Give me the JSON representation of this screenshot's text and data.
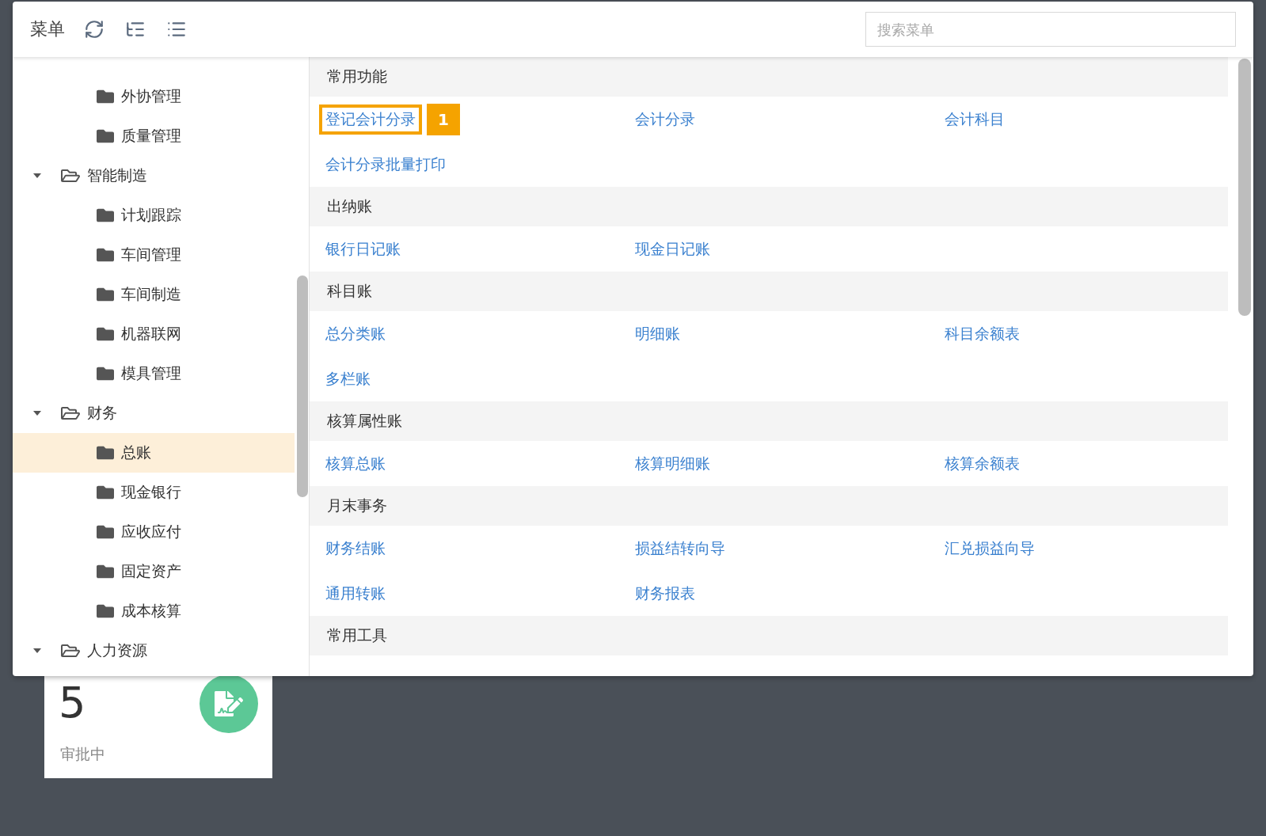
{
  "menu": {
    "title": "菜单",
    "search": {
      "placeholder": "搜索菜单"
    }
  },
  "tree": {
    "partial_items": [
      {
        "label": "外协管理",
        "selected": false
      },
      {
        "label": "质量管理",
        "selected": false
      }
    ],
    "groups": [
      {
        "label": "智能制造",
        "expanded": true,
        "children": [
          {
            "label": "计划跟踪",
            "selected": false
          },
          {
            "label": "车间管理",
            "selected": false
          },
          {
            "label": "车间制造",
            "selected": false
          },
          {
            "label": "机器联网",
            "selected": false
          },
          {
            "label": "模具管理",
            "selected": false
          }
        ]
      },
      {
        "label": "财务",
        "expanded": true,
        "children": [
          {
            "label": "总账",
            "selected": true
          },
          {
            "label": "现金银行",
            "selected": false
          },
          {
            "label": "应收应付",
            "selected": false
          },
          {
            "label": "固定资产",
            "selected": false
          },
          {
            "label": "成本核算",
            "selected": false
          }
        ]
      },
      {
        "label": "人力资源",
        "expanded": true
      }
    ]
  },
  "sections": [
    {
      "title": "常用功能",
      "links": [
        {
          "label": "登记会计分录",
          "highlighted": true,
          "badge": "1"
        },
        {
          "label": "会计分录",
          "highlighted": false
        },
        {
          "label": "会计科目",
          "highlighted": false
        },
        {
          "label": "会计分录批量打印",
          "highlighted": false
        }
      ]
    },
    {
      "title": "出纳账",
      "links": [
        {
          "label": "银行日记账",
          "highlighted": false
        },
        {
          "label": "现金日记账",
          "highlighted": false
        }
      ]
    },
    {
      "title": "科目账",
      "links": [
        {
          "label": "总分类账",
          "highlighted": false
        },
        {
          "label": "明细账",
          "highlighted": false
        },
        {
          "label": "科目余额表",
          "highlighted": false
        },
        {
          "label": "多栏账",
          "highlighted": false
        }
      ]
    },
    {
      "title": "核算属性账",
      "links": [
        {
          "label": "核算总账",
          "highlighted": false
        },
        {
          "label": "核算明细账",
          "highlighted": false
        },
        {
          "label": "核算余额表",
          "highlighted": false
        }
      ]
    },
    {
      "title": "月末事务",
      "links": [
        {
          "label": "财务结账",
          "highlighted": false
        },
        {
          "label": "损益结转向导",
          "highlighted": false
        },
        {
          "label": "汇兑损益向导",
          "highlighted": false
        },
        {
          "label": "通用转账",
          "highlighted": false
        },
        {
          "label": "财务报表",
          "highlighted": false
        }
      ]
    },
    {
      "title": "常用工具"
    }
  ],
  "stat_card": {
    "value": "5",
    "label": "审批中"
  }
}
